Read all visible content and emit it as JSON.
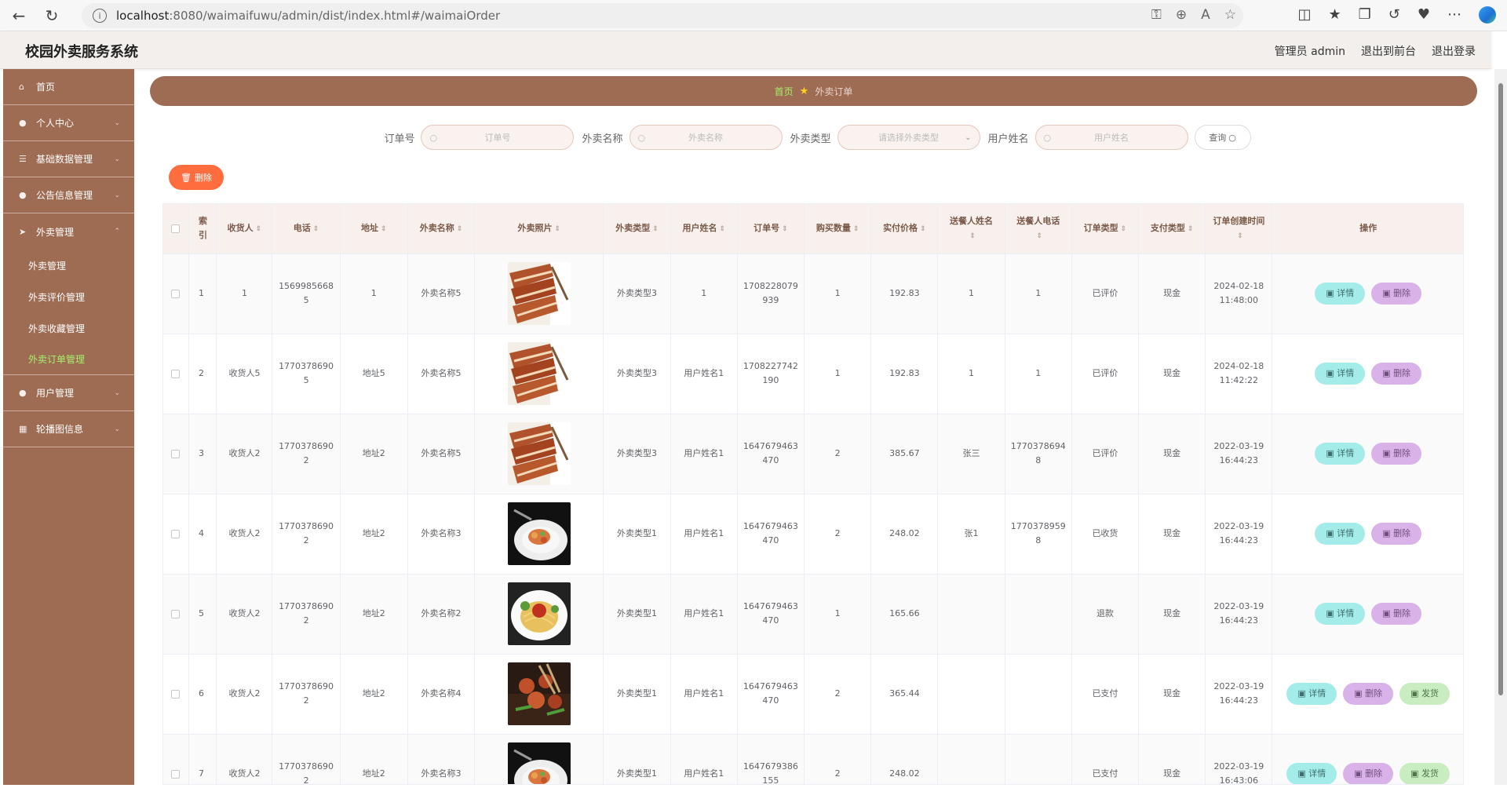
{
  "browser": {
    "url_host": "localhost",
    "url_path": ":8080/waimaifuwu/admin/dist/index.html#/waimaiOrder"
  },
  "header": {
    "title": "校园外卖服务系统",
    "admin_label": "管理员 admin",
    "back_to_front": "退出到前台",
    "logout": "退出登录"
  },
  "sidebar": {
    "items": [
      {
        "label": "首页",
        "icon": "home-icon"
      },
      {
        "label": "个人中心",
        "icon": "user-icon"
      },
      {
        "label": "基础数据管理",
        "icon": "list-icon"
      },
      {
        "label": "公告信息管理",
        "icon": "user-icon"
      },
      {
        "label": "外卖管理",
        "icon": "send-icon"
      }
    ],
    "sub_items": [
      {
        "label": "外卖管理"
      },
      {
        "label": "外卖评价管理"
      },
      {
        "label": "外卖收藏管理"
      },
      {
        "label": "外卖订单管理"
      }
    ],
    "after_items": [
      {
        "label": "用户管理",
        "icon": "user-icon"
      },
      {
        "label": "轮播图信息",
        "icon": "image-icon"
      }
    ]
  },
  "breadcrumb": {
    "home": "首页",
    "current": "外卖订单"
  },
  "search": {
    "order_no_label": "订单号",
    "order_no_placeholder": "订单号",
    "food_name_label": "外卖名称",
    "food_name_placeholder": "外卖名称",
    "food_type_label": "外卖类型",
    "food_type_placeholder": "请选择外卖类型",
    "user_name_label": "用户姓名",
    "user_name_placeholder": "用户姓名",
    "query_button": "查询"
  },
  "toolbar": {
    "delete_label": "删除"
  },
  "table": {
    "columns": [
      "索引",
      "收货人",
      "电话",
      "地址",
      "外卖名称",
      "外卖照片",
      "外卖类型",
      "用户姓名",
      "订单号",
      "购买数量",
      "实付价格",
      "送餐人姓名",
      "送餐人电话",
      "订单类型",
      "支付类型",
      "订单创建时间",
      "操作"
    ],
    "actions": {
      "view": "详情",
      "delete": "删除",
      "ship": "发货"
    },
    "rows": [
      {
        "idx": "1",
        "receiver": "1",
        "phone": "15699856685",
        "address": "1",
        "food": "外卖名称5",
        "photo": "pork",
        "type": "外卖类型3",
        "user": "1",
        "order": "1708228079939",
        "qty": "1",
        "price": "192.83",
        "courier": "1",
        "courier_phone": "1",
        "status": "已评价",
        "pay": "现金",
        "created": "2024-02-18 11:48:00",
        "ship": false
      },
      {
        "idx": "2",
        "receiver": "收货人5",
        "phone": "17703786905",
        "address": "地址5",
        "food": "外卖名称5",
        "photo": "pork",
        "type": "外卖类型3",
        "user": "用户姓名1",
        "order": "1708227742190",
        "qty": "1",
        "price": "192.83",
        "courier": "1",
        "courier_phone": "1",
        "status": "已评价",
        "pay": "现金",
        "created": "2024-02-18 11:42:22",
        "ship": false
      },
      {
        "idx": "3",
        "receiver": "收货人2",
        "phone": "17703786902",
        "address": "地址2",
        "food": "外卖名称5",
        "photo": "pork",
        "type": "外卖类型3",
        "user": "用户姓名1",
        "order": "1647679463470",
        "qty": "2",
        "price": "385.67",
        "courier": "张三",
        "courier_phone": "17703786948",
        "status": "已评价",
        "pay": "现金",
        "created": "2022-03-19 16:44:23",
        "ship": false
      },
      {
        "idx": "4",
        "receiver": "收货人2",
        "phone": "17703786902",
        "address": "地址2",
        "food": "外卖名称3",
        "photo": "plate",
        "type": "外卖类型1",
        "user": "用户姓名1",
        "order": "1647679463470",
        "qty": "2",
        "price": "248.02",
        "courier": "张1",
        "courier_phone": "17703789598",
        "status": "已收货",
        "pay": "现金",
        "created": "2022-03-19 16:44:23",
        "ship": false
      },
      {
        "idx": "5",
        "receiver": "收货人2",
        "phone": "17703786902",
        "address": "地址2",
        "food": "外卖名称2",
        "photo": "pasta",
        "type": "外卖类型1",
        "user": "用户姓名1",
        "order": "1647679463470",
        "qty": "1",
        "price": "165.66",
        "courier": "",
        "courier_phone": "",
        "status": "退款",
        "pay": "现金",
        "created": "2022-03-19 16:44:23",
        "ship": false
      },
      {
        "idx": "6",
        "receiver": "收货人2",
        "phone": "17703786902",
        "address": "地址2",
        "food": "外卖名称4",
        "photo": "stirfry",
        "type": "外卖类型1",
        "user": "用户姓名1",
        "order": "1647679463470",
        "qty": "2",
        "price": "365.44",
        "courier": "",
        "courier_phone": "",
        "status": "已支付",
        "pay": "现金",
        "created": "2022-03-19 16:44:23",
        "ship": true
      },
      {
        "idx": "7",
        "receiver": "收货人2",
        "phone": "17703786902",
        "address": "地址2",
        "food": "外卖名称3",
        "photo": "plate",
        "type": "外卖类型1",
        "user": "用户姓名1",
        "order": "1647679386155",
        "qty": "2",
        "price": "248.02",
        "courier": "",
        "courier_phone": "",
        "status": "已支付",
        "pay": "现金",
        "created": "2022-03-19 16:43:06",
        "ship": true
      }
    ]
  },
  "colors": {
    "brand": "#9e6b53",
    "active_menu": "#a5f06b",
    "delete_button": "#ff6d3f"
  }
}
